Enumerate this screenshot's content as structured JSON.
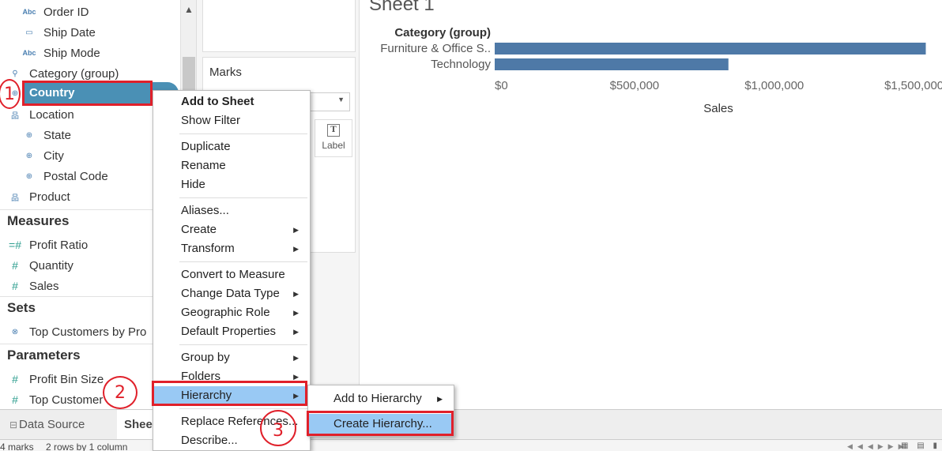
{
  "dimensions": {
    "fields": [
      {
        "label": "Order ID",
        "icon": "abc-string-icon",
        "glyph": "Abc"
      },
      {
        "label": "Ship Date",
        "icon": "calendar-icon",
        "glyph": "▭"
      },
      {
        "label": "Ship Mode",
        "icon": "abc-string-icon",
        "glyph": "Abc"
      },
      {
        "label": "Category (group)",
        "icon": "paperclip-icon",
        "glyph": "⚲"
      },
      {
        "label": "Country",
        "icon": "globe-icon",
        "glyph": "⊕"
      },
      {
        "label": "Location",
        "icon": "hierarchy-icon",
        "glyph": "品"
      },
      {
        "label": "State",
        "icon": "globe-icon",
        "glyph": "⊕"
      },
      {
        "label": "City",
        "icon": "globe-icon",
        "glyph": "⊕"
      },
      {
        "label": "Postal Code",
        "icon": "globe-icon",
        "glyph": "⊕"
      },
      {
        "label": "Product",
        "icon": "hierarchy-icon",
        "glyph": "品"
      }
    ]
  },
  "measures": {
    "heading": "Measures",
    "fields": [
      {
        "label": "Profit Ratio",
        "glyph": "=#"
      },
      {
        "label": "Quantity",
        "glyph": "#"
      },
      {
        "label": "Sales",
        "glyph": "#"
      }
    ]
  },
  "sets": {
    "heading": "Sets",
    "fields": [
      {
        "label": "Top Customers by Pro",
        "glyph": "⊗"
      }
    ]
  },
  "parameters": {
    "heading": "Parameters",
    "fields": [
      {
        "label": "Profit Bin Size",
        "glyph": "#"
      },
      {
        "label": "Top Customer",
        "glyph": "#"
      }
    ]
  },
  "annotations": {
    "step1": "1",
    "step2": "2",
    "step3": "3"
  },
  "marks_card": {
    "title": "Marks",
    "label_button": "Label",
    "label_glyph": "T"
  },
  "sheet": {
    "title": "Sheet 1"
  },
  "chart_data": {
    "type": "bar",
    "orientation": "horizontal",
    "row_header": "Category (group)",
    "categories": [
      "Furniture & Office S..",
      "Technology"
    ],
    "values": [
      1542000,
      836000
    ],
    "xlabel": "Sales",
    "xlim": [
      0,
      1600000
    ],
    "ticks": [
      {
        "value": 0,
        "label": "$0"
      },
      {
        "value": 500000,
        "label": "$500,000"
      },
      {
        "value": 1000000,
        "label": "$1,000,000"
      },
      {
        "value": 1500000,
        "label": "$1,500,000"
      }
    ],
    "bar_color": "#4e79a7"
  },
  "context_menu": {
    "items": [
      {
        "label": "Add to Sheet",
        "bold": true
      },
      {
        "label": "Show Filter"
      },
      {
        "sep": true
      },
      {
        "label": "Duplicate"
      },
      {
        "label": "Rename"
      },
      {
        "label": "Hide"
      },
      {
        "sep": true
      },
      {
        "label": "Aliases..."
      },
      {
        "label": "Create",
        "submenu": true
      },
      {
        "label": "Transform",
        "submenu": true
      },
      {
        "sep": true
      },
      {
        "label": "Convert to Measure"
      },
      {
        "label": "Change Data Type",
        "submenu": true
      },
      {
        "label": "Geographic Role",
        "submenu": true
      },
      {
        "label": "Default Properties",
        "submenu": true
      },
      {
        "sep": true
      },
      {
        "label": "Group by",
        "submenu": true
      },
      {
        "label": "Folders",
        "submenu": true
      },
      {
        "label": "Hierarchy",
        "submenu": true,
        "highlighted": true
      },
      {
        "sep": true
      },
      {
        "label": "Replace References..."
      },
      {
        "label": "Describe..."
      }
    ]
  },
  "hierarchy_submenu": {
    "items": [
      {
        "label": "Add to Hierarchy",
        "submenu": true
      },
      {
        "label": "Create Hierarchy...",
        "highlighted": true
      }
    ]
  },
  "tabs": {
    "data_source": "Data Source",
    "sheet": "Sheet 1"
  },
  "status": {
    "marks": "4 marks",
    "rows": "2 rows by 1 column"
  },
  "colors": {
    "accent_red": "#e0202a",
    "pill_blue": "#4a90b5",
    "menu_highlight": "#99c9f4"
  }
}
